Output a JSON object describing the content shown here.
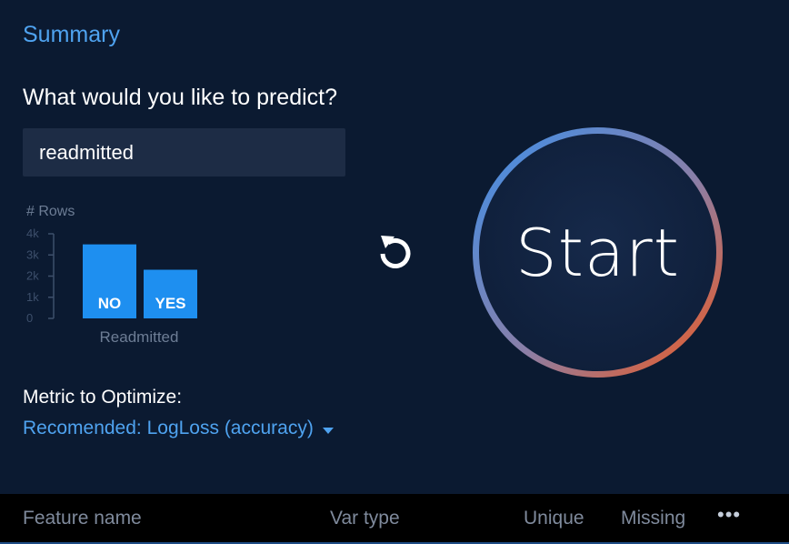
{
  "summary": {
    "title": "Summary",
    "question": "What would you like to predict?",
    "target_value": "readmitted"
  },
  "chart_data": {
    "type": "bar",
    "title": "# Rows",
    "xlabel": "Readmitted",
    "ylabel": "",
    "categories": [
      "NO",
      "YES"
    ],
    "values": [
      3500,
      2300
    ],
    "ylim": [
      0,
      4000
    ],
    "yticks": [
      "4k",
      "3k",
      "2k",
      "1k",
      "0"
    ],
    "bar_color": "#1e8ff0",
    "grid": false
  },
  "metric": {
    "label": "Metric to Optimize:",
    "selected": "Recomended: LogLoss (accuracy)"
  },
  "actions": {
    "start_label": "Start",
    "reset_icon": "rotate-ccw-icon"
  },
  "table": {
    "columns": [
      "Feature name",
      "Var type",
      "Unique",
      "Missing"
    ],
    "more_label": "•••"
  },
  "colors": {
    "accent": "#4fa3f0",
    "background": "#0b1a31",
    "ring_start": "#3f8fe8",
    "ring_end": "#f0591e"
  }
}
